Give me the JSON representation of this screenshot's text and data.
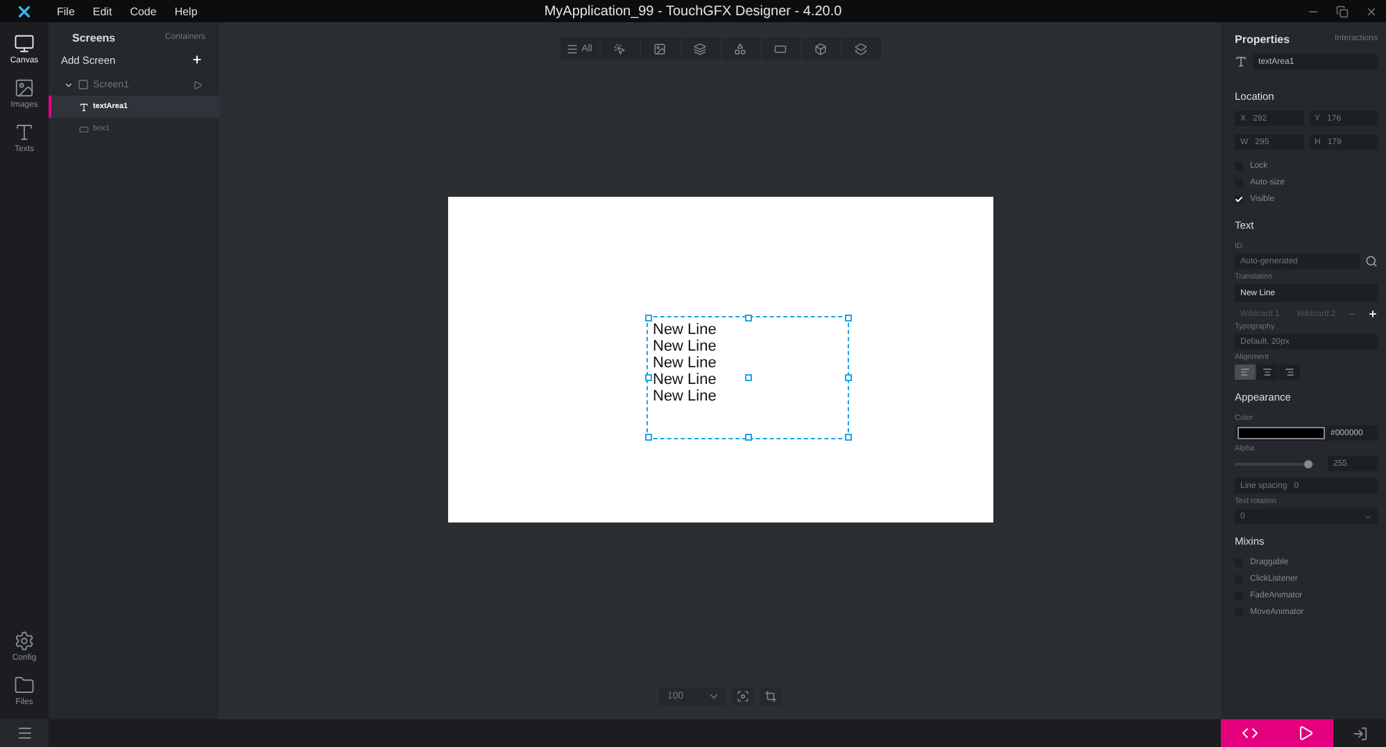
{
  "window": {
    "title": "MyApplication_99 - TouchGFX Designer - 4.20.0"
  },
  "menu": [
    "File",
    "Edit",
    "Code",
    "Help"
  ],
  "rail": {
    "top": [
      {
        "label": "Canvas",
        "kind": "canvas",
        "selected": true
      },
      {
        "label": "Images",
        "kind": "images",
        "selected": false
      },
      {
        "label": "Texts",
        "kind": "texts",
        "selected": false
      }
    ],
    "bottom": [
      {
        "label": "Config",
        "kind": "config",
        "selected": false
      },
      {
        "label": "Files",
        "kind": "files",
        "selected": false
      }
    ]
  },
  "tree_panel": {
    "tabs": [
      {
        "label": "Screens",
        "selected": true
      },
      {
        "label": "Containers",
        "selected": false
      }
    ],
    "add_screen": "Add Screen",
    "tree": [
      {
        "label": "Screen1",
        "kind": "screen",
        "expanded": true,
        "selected": false,
        "children": [
          {
            "label": "textArea1",
            "kind": "text",
            "selected": true
          },
          {
            "label": "box1",
            "kind": "box",
            "selected": false
          }
        ]
      }
    ]
  },
  "toolbar": [
    {
      "kind": "all",
      "label": "All",
      "selected": false
    },
    {
      "kind": "interaction",
      "selected": false
    },
    {
      "kind": "image",
      "selected": false
    },
    {
      "kind": "container",
      "selected": false
    },
    {
      "kind": "shape",
      "selected": false
    },
    {
      "kind": "progress",
      "selected": false
    },
    {
      "kind": "cube",
      "selected": false
    },
    {
      "kind": "layers",
      "selected": false
    }
  ],
  "canvas": {
    "text_lines": [
      "New Line",
      "New Line",
      "New Line",
      "New Line",
      "New Line"
    ]
  },
  "zoom": {
    "value": "100"
  },
  "properties": {
    "tabs": [
      {
        "label": "Properties",
        "selected": true
      },
      {
        "label": "Interactions",
        "selected": false
      }
    ],
    "widget_name": "textArea1",
    "location": {
      "title": "Location",
      "fields": [
        {
          "label": "X",
          "value": "292"
        },
        {
          "label": "Y",
          "value": "176"
        },
        {
          "label": "W",
          "value": "295"
        },
        {
          "label": "H",
          "value": "179"
        }
      ],
      "options": [
        {
          "label": "Lock",
          "checked": false
        },
        {
          "label": "Auto-size",
          "checked": false
        },
        {
          "label": "Visible",
          "checked": true
        }
      ]
    },
    "text": {
      "title": "Text",
      "id_label": "ID",
      "id_placeholder": "Auto-generated",
      "translation_label": "Translation",
      "translation": "New Line",
      "wildcards": [
        "Wildcard 1",
        "Wildcard 2"
      ],
      "typography_label": "Typography",
      "typography": "Default, 20px",
      "alignment_label": "Alignment",
      "alignments": [
        {
          "kind": "left",
          "selected": true
        },
        {
          "kind": "center",
          "selected": false
        },
        {
          "kind": "right",
          "selected": false
        }
      ]
    },
    "appearance": {
      "title": "Appearance",
      "color_label": "Color",
      "color": "#000000",
      "alpha_label": "Alpha",
      "level": 0.93,
      "alpha": "255",
      "line_spacing_label": "Line spacing",
      "line_spacing": "0",
      "rotation_label": "Text rotation",
      "rotation": "0"
    },
    "mixins": {
      "title": "Mixins",
      "items": [
        {
          "label": "Draggable",
          "checked": false
        },
        {
          "label": "ClickListener",
          "checked": false
        },
        {
          "label": "FadeAnimator",
          "checked": false
        },
        {
          "label": "MoveAnimator",
          "checked": false
        }
      ]
    }
  }
}
